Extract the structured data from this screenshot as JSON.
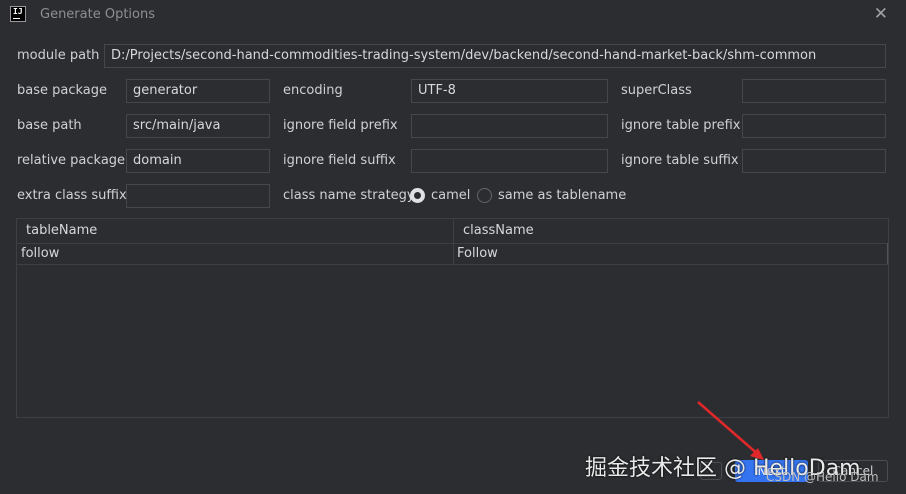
{
  "window": {
    "title": "Generate Options",
    "close_glyph": "✕",
    "app_icon_text": "IJ"
  },
  "labels": {
    "module_path": "module path",
    "base_package": "base package",
    "encoding": "encoding",
    "super_class": "superClass",
    "base_path": "base path",
    "ignore_field_prefix": "ignore field prefix",
    "ignore_table_prefix": "ignore table prefix",
    "relative_package": "relative package",
    "ignore_field_suffix": "ignore field suffix",
    "ignore_table_suffix": "ignore table suffix",
    "extra_class_suffix": "extra class suffix",
    "class_name_strategy": "class name strategy"
  },
  "values": {
    "module_path": "D:/Projects/second-hand-commodities-trading-system/dev/backend/second-hand-market-back/shm-common",
    "base_package": "generator",
    "encoding": "UTF-8",
    "super_class": "",
    "base_path": "src/main/java",
    "ignore_field_prefix": "",
    "ignore_table_prefix": "",
    "relative_package": "domain",
    "ignore_field_suffix": "",
    "ignore_table_suffix": "",
    "extra_class_suffix": ""
  },
  "strategy": {
    "camel": "camel",
    "same_as_tablename": "same as tablename",
    "selected": "camel"
  },
  "table": {
    "columns": [
      "tableName",
      "className"
    ],
    "rows": [
      [
        "follow",
        "Follow"
      ]
    ]
  },
  "buttons": {
    "ok": "Next",
    "cancel": "Cancel"
  },
  "watermark": {
    "main": "掘金技术社区 @ HelloDam",
    "sub": "CSDN @Hello Dam"
  },
  "colors": {
    "accent": "#3574f0",
    "background": "#2b2d30",
    "border": "#44474c"
  }
}
